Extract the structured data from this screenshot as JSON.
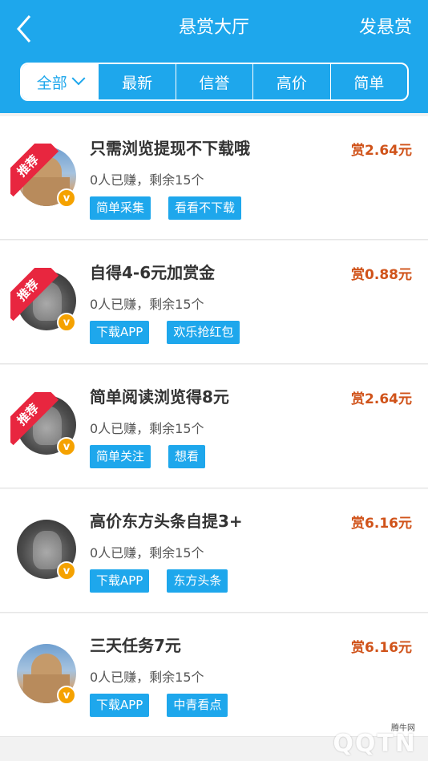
{
  "header": {
    "title": "悬赏大厅",
    "post_label": "发悬赏",
    "back_icon": "chevron-left-icon",
    "bg_color": "#1ea7ec"
  },
  "tabs": [
    {
      "label": "全部",
      "selected": true
    },
    {
      "label": "最新"
    },
    {
      "label": "信誉"
    },
    {
      "label": "高价"
    },
    {
      "label": "简单"
    }
  ],
  "items": [
    {
      "title": "只需浏览提现不下载哦",
      "reward": "赏2.64元",
      "meta": "0人已赚，剩余15个",
      "tags": [
        "简单采集",
        "看看不下载"
      ],
      "badge": "推荐"
    },
    {
      "title": "自得4-6元加赏金",
      "reward": "赏0.88元",
      "meta": "0人已赚，剩余15个",
      "tags": [
        "下载APP",
        "欢乐抢红包"
      ],
      "badge": "推荐"
    },
    {
      "title": "简单阅读浏览得8元",
      "reward": "赏2.64元",
      "meta": "0人已赚，剩余15个",
      "tags": [
        "简单关注",
        "想看"
      ],
      "badge": "推荐"
    },
    {
      "title": "高价东方头条自提3+",
      "reward": "赏6.16元",
      "meta": "0人已赚，剩余15个",
      "tags": [
        "下载APP",
        "东方头条"
      ],
      "badge": ""
    },
    {
      "title": "三天任务7元",
      "reward": "赏6.16元",
      "meta": "0人已赚，剩余15个",
      "tags": [
        "下载APP",
        "中青看点"
      ],
      "badge": ""
    }
  ],
  "watermark": {
    "text": "QQTN",
    "small": "腾牛网"
  },
  "colors": {
    "accent": "#1ea7ec",
    "reward": "#d0531a",
    "badge": "#e8263f",
    "vip": "#f5a200"
  }
}
